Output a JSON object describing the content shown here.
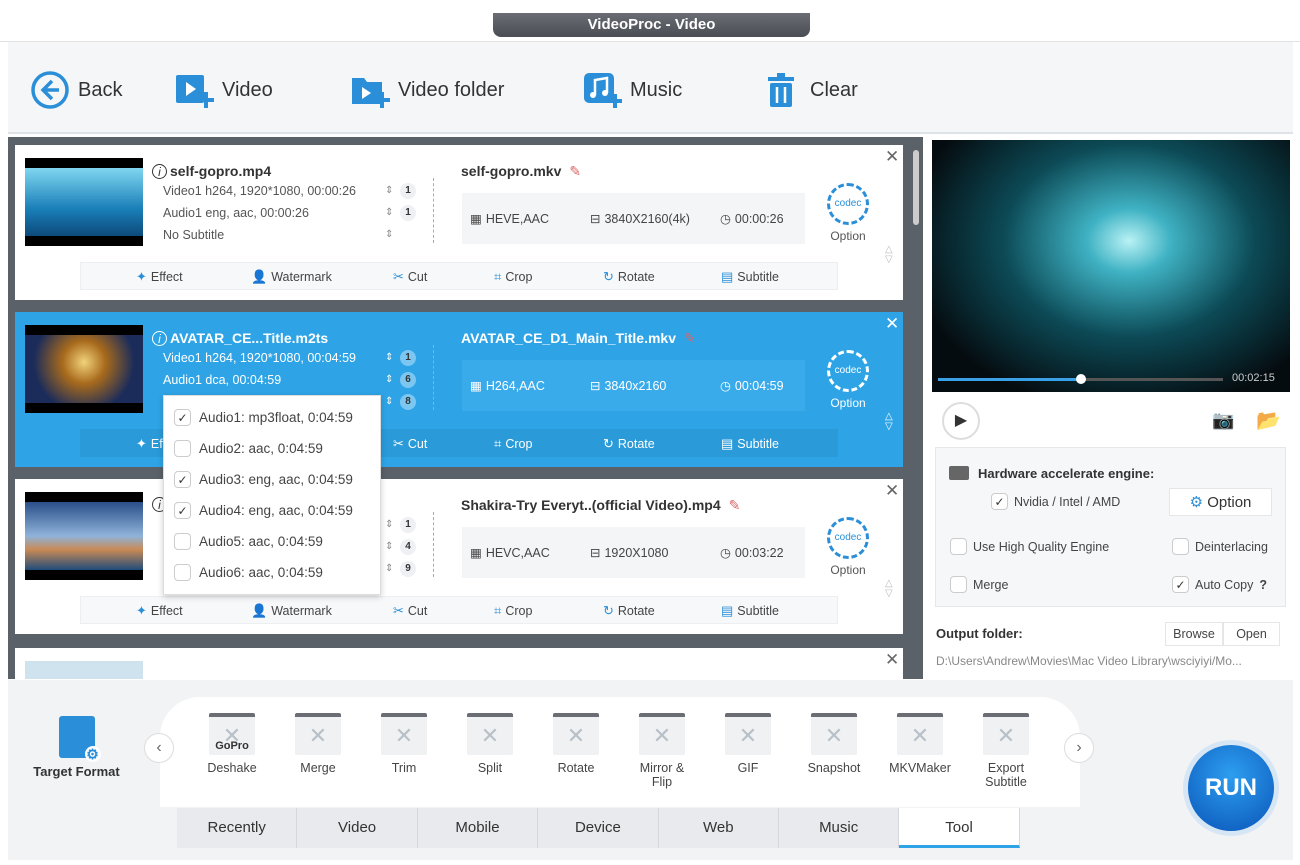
{
  "window": {
    "title": "VideoProc - Video"
  },
  "toolbar": {
    "back": "Back",
    "video": "Video",
    "video_folder": "Video folder",
    "music": "Music",
    "clear": "Clear"
  },
  "actions": [
    "Effect",
    "Watermark",
    "Cut",
    "Crop",
    "Rotate",
    "Subtitle"
  ],
  "codec_label": "Option",
  "videos": [
    {
      "input": "self-gopro.mp4",
      "video": "Video1  h264, 1920*1080, 00:00:26",
      "video_n": "1",
      "audio": "Audio1  eng, aac, 00:00:26",
      "audio_n": "1",
      "subtitle": "No Subtitle",
      "subtitle_n": "",
      "output": "self-gopro.mkv",
      "codec": "HEVE,AAC",
      "resolution": "3840X2160(4k)",
      "duration": "00:00:26",
      "selected": false
    },
    {
      "input": "AVATAR_CE...Title.m2ts",
      "video": "Video1  h264, 1920*1080, 00:04:59",
      "video_n": "1",
      "audio": "Audio1  dca,  00:04:59",
      "audio_n": "6",
      "subtitle": "",
      "subtitle_n": "8",
      "output": "AVATAR_CE_D1_Main_Title.mkv",
      "codec": "H264,AAC",
      "resolution": "3840x2160",
      "duration": "00:04:59",
      "selected": true
    },
    {
      "input": "",
      "video": "",
      "video_n": "1",
      "audio": "",
      "audio_n": "4",
      "subtitle": "",
      "subtitle_n": "9",
      "output": "Shakira-Try Everyt..(official Video).mp4",
      "codec": "HEVC,AAC",
      "resolution": "1920X1080",
      "duration": "00:03:22",
      "selected": false
    }
  ],
  "audio_popup": [
    {
      "label": "Audio1: mp3float, 0:04:59",
      "checked": true
    },
    {
      "label": "Audio2: aac, 0:04:59",
      "checked": false
    },
    {
      "label": "Audio3: eng, aac, 0:04:59",
      "checked": true
    },
    {
      "label": "Audio4: eng, aac, 0:04:59",
      "checked": true
    },
    {
      "label": "Audio5: aac, 0:04:59",
      "checked": false
    },
    {
      "label": "Audio6: aac, 0:04:59",
      "checked": false
    }
  ],
  "preview": {
    "time": "00:02:15",
    "progress": 0.5
  },
  "settings": {
    "hw_title": "Hardware accelerate engine:",
    "hw_option": "Nvidia / Intel / AMD",
    "hw_checked": true,
    "option_button": "Option",
    "high_quality": "Use High Quality Engine",
    "deinterlacing": "Deinterlacing",
    "merge": "Merge",
    "auto_copy": "Auto Copy",
    "help": "?"
  },
  "output": {
    "label": "Output folder:",
    "browse": "Browse",
    "open": "Open",
    "path": "D:\\Users\\Andrew\\Movies\\Mac Video Library\\wsciyiyi/Mo..."
  },
  "target_format": "Target Format",
  "tools": [
    {
      "label": "Deshake",
      "badge": "GoPro"
    },
    {
      "label": "Merge"
    },
    {
      "label": "Trim"
    },
    {
      "label": "Split"
    },
    {
      "label": "Rotate"
    },
    {
      "label": "Mirror &\nFlip"
    },
    {
      "label": "GIF"
    },
    {
      "label": "Snapshot"
    },
    {
      "label": "MKVMaker"
    },
    {
      "label": "Export\nSubtitle"
    }
  ],
  "tabs": [
    "Recently",
    "Video",
    "Mobile",
    "Device",
    "Web",
    "Music",
    "Tool"
  ],
  "active_tab": "Tool",
  "run": "RUN",
  "colors": {
    "accent": "#2ea4e6",
    "panel": "#5b6168"
  }
}
